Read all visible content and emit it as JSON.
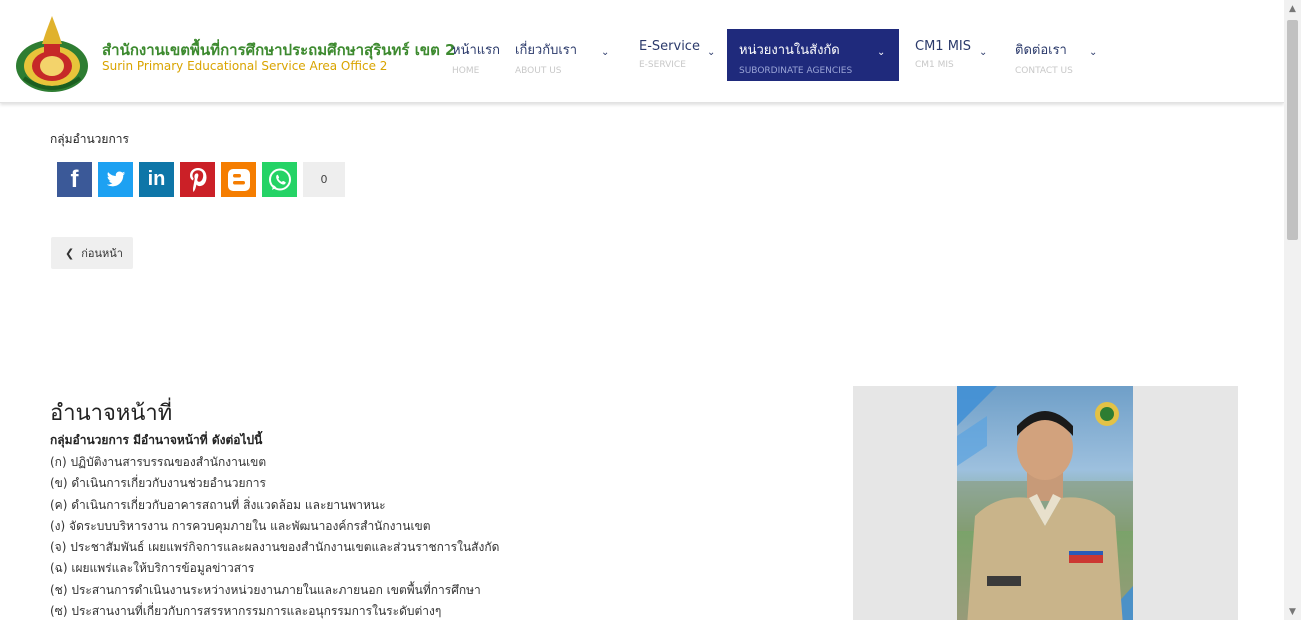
{
  "header": {
    "org_name_th": "สำนักงานเขตพื้นที่การศึกษาประถมศึกษาสุรินทร์ เขต 2",
    "org_name_en": "Surin Primary Educational Service Area Office 2",
    "logo_icon": "school-emblem-icon"
  },
  "nav": [
    {
      "label": "หน้าแรก",
      "sub": "HOME",
      "has_dropdown": false,
      "active": false
    },
    {
      "label": "เกี่ยวกับเรา",
      "sub": "ABOUT US",
      "has_dropdown": true,
      "active": false
    },
    {
      "label": "E-Service",
      "sub": "E-SERVICE",
      "has_dropdown": true,
      "active": false
    },
    {
      "label": "หน่วยงานในสังกัด",
      "sub": "SUBORDINATE AGENCIES",
      "has_dropdown": true,
      "active": true
    },
    {
      "label": "CM1 MIS",
      "sub": "CM1 MIS",
      "has_dropdown": true,
      "active": false
    },
    {
      "label": "ติดต่อเรา",
      "sub": "CONTACT US",
      "has_dropdown": true,
      "active": false
    }
  ],
  "chevron_glyph": "⌄",
  "content": {
    "group_title": "กลุ่มอำนวยการ",
    "share_buttons": [
      {
        "icon": "facebook-icon",
        "glyph": "f",
        "color": "#3b5998"
      },
      {
        "icon": "twitter-icon",
        "glyph": "🐦",
        "color": "#1da1f2"
      },
      {
        "icon": "linkedin-icon",
        "glyph": "in",
        "color": "#0e76a8"
      },
      {
        "icon": "pinterest-icon",
        "glyph": "P",
        "color": "#cb2027"
      },
      {
        "icon": "blogger-icon",
        "glyph": "B",
        "color": "#f57d00"
      },
      {
        "icon": "whatsapp-icon",
        "glyph": "✆",
        "color": "#25d366"
      }
    ],
    "share_count": "0",
    "back_label": "ก่อนหน้า",
    "back_arrow": "❮",
    "duty_heading": "อำนาจหน้าที่",
    "duty_intro": "กลุ่มอำนวยการ มีอำนาจหน้าที่ ดังต่อไปนี้",
    "duties": [
      "(ก) ปฏิบัติงานสารบรรณของสำนักงานเขต",
      "(ข) ดำเนินการเกี่ยวกับงานช่วยอำนวยการ",
      "(ค) ดำเนินการเกี่ยวกับอาคารสถานที่ สิ่งแวดล้อม และยานพาหนะ",
      "(ง) จัดระบบบริหารงาน การควบคุมภายใน และพัฒนาองค์กรสำนักงานเขต",
      "(จ) ประชาสัมพันธ์ เผยแพร่กิจการและผลงานของสำนักงานเขตและส่วนราชการในสังกัด",
      "(ฉ) เผยแพร่และให้บริการข้อมูลข่าวสาร",
      "(ช) ประสานการดำเนินงานระหว่างหน่วยงานภายในและภายนอก เขตพื้นที่การศึกษา",
      "(ซ) ประสานงานที่เกี่ยวกับการสรรหากรรมการและอนุกรรมการในระดับต่างๆ"
    ]
  },
  "colors": {
    "nav_active_bg": "#1f2a7c",
    "org_name_th": "#3d8a2f",
    "org_name_en": "#d9a400"
  }
}
